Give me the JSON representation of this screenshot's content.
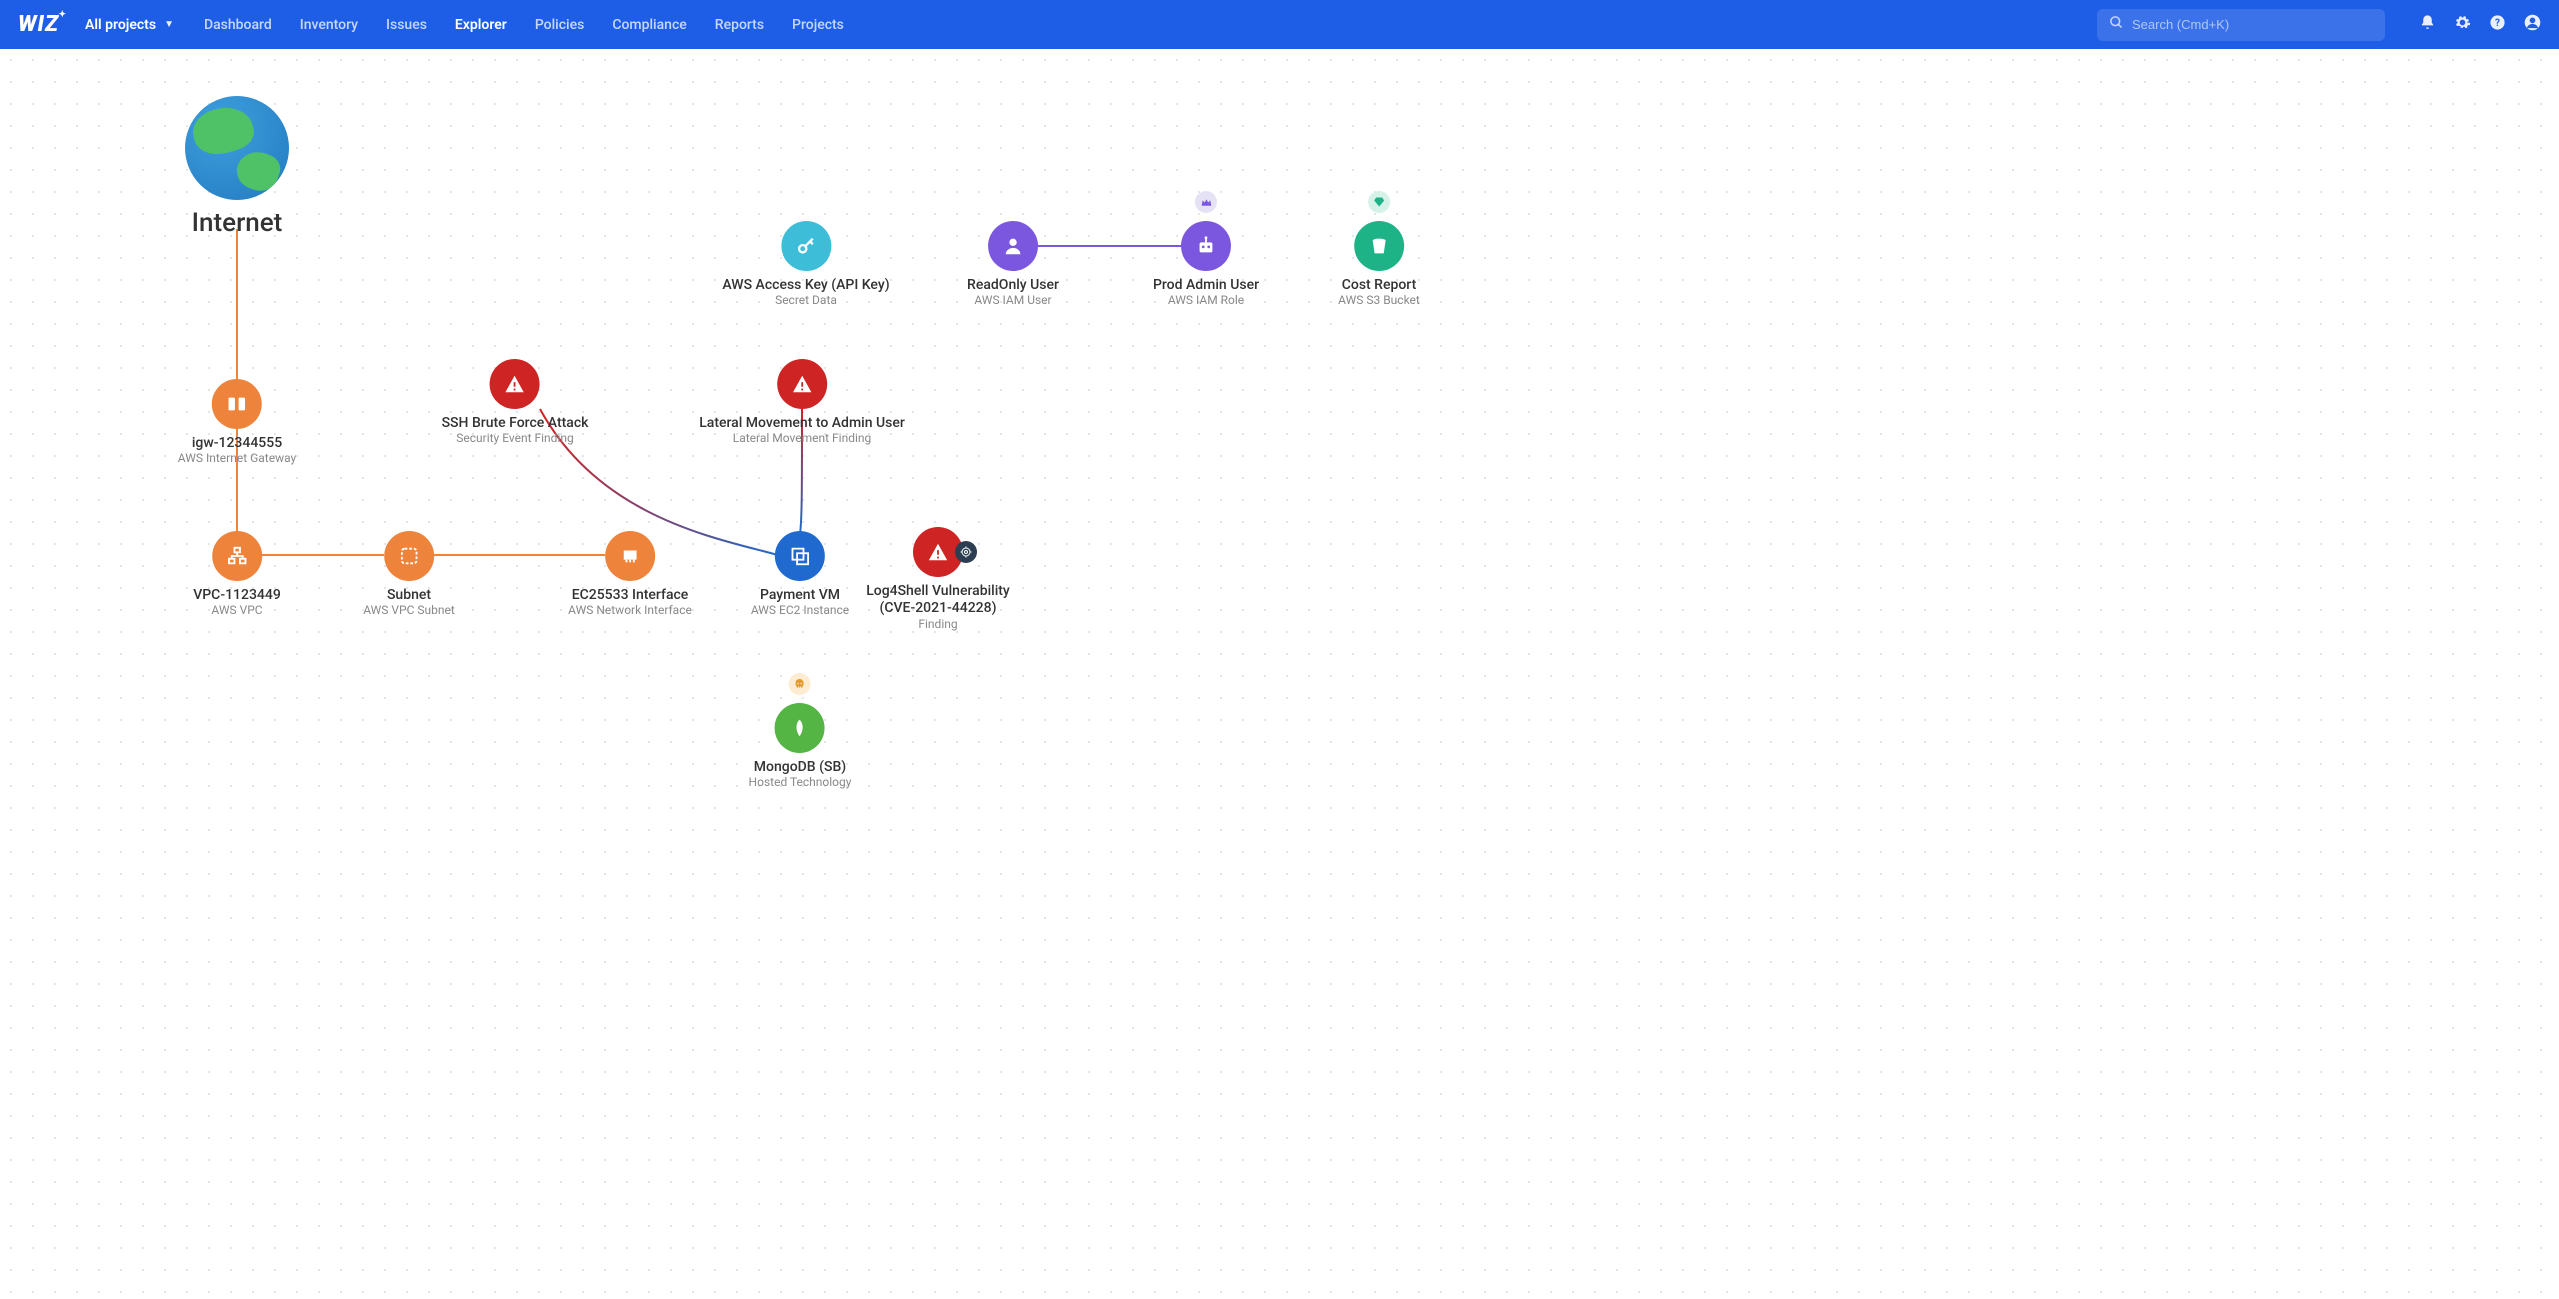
{
  "header": {
    "logo": "WIZ",
    "project_selector": "All projects",
    "nav": [
      "Dashboard",
      "Inventory",
      "Issues",
      "Explorer",
      "Policies",
      "Compliance",
      "Reports",
      "Projects"
    ],
    "active_nav": "Explorer",
    "search_placeholder": "Search (Cmd+K)"
  },
  "nodes": {
    "internet": {
      "title": "Internet",
      "sub": "",
      "color": "#2e8dd4"
    },
    "igw": {
      "title": "igw-12344555",
      "sub": "AWS Internet Gateway",
      "color": "#ee833c"
    },
    "vpc": {
      "title": "VPC-1123449",
      "sub": "AWS VPC",
      "color": "#ee833c"
    },
    "subnet": {
      "title": "Subnet",
      "sub": "AWS VPC Subnet",
      "color": "#ee833c"
    },
    "eni": {
      "title": "EC25533 Interface",
      "sub": "AWS Network Interface",
      "color": "#ee833c"
    },
    "vm": {
      "title": "Payment VM",
      "sub": "AWS EC2 Instance",
      "color": "#2069cf"
    },
    "ssh": {
      "title": "SSH Brute Force Attack",
      "sub": "Security Event Finding",
      "color": "#cf2424"
    },
    "lateral": {
      "title": "Lateral Movement to Admin User",
      "sub": "Lateral Movement Finding",
      "color": "#cf2424"
    },
    "log4": {
      "title": "Log4Shell Vulnerability (CVE-2021-44228)",
      "sub": "Finding",
      "color": "#cf2424"
    },
    "key": {
      "title": "AWS Access Key (API Key)",
      "sub": "Secret Data",
      "color": "#3dbdd8"
    },
    "readonly": {
      "title": "ReadOnly User",
      "sub": "AWS IAM User",
      "color": "#7b57e0"
    },
    "admin": {
      "title": "Prod Admin User",
      "sub": "AWS IAM Role",
      "color": "#7b57e0"
    },
    "bucket": {
      "title": "Cost Report",
      "sub": "AWS S3 Bucket",
      "color": "#1eb386"
    },
    "mongo": {
      "title": "MongoDB (SB)",
      "sub": "Hosted Technology",
      "color": "#54b545"
    }
  },
  "badges": {
    "admin_crown": "crown-icon",
    "bucket_gem": "gem-icon",
    "log4_target": "target-icon",
    "mongo_skull": "skull-icon"
  },
  "colors": {
    "header_bg": "#1e5ee6",
    "orange": "#ee833c",
    "red": "#cf2424",
    "blue": "#2069cf",
    "cyan": "#3dbdd8",
    "purple": "#7b57e0",
    "green": "#1eb386",
    "leaf": "#54b545"
  }
}
